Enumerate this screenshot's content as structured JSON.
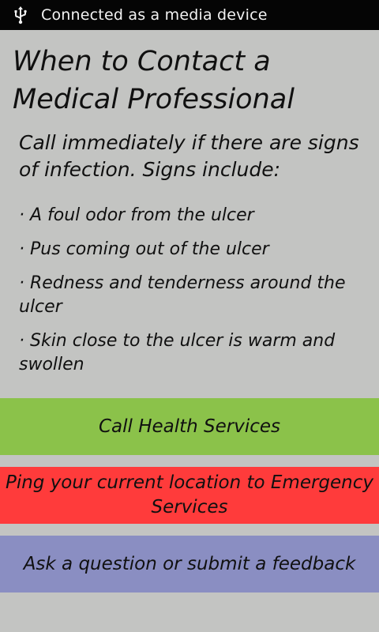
{
  "status_bar": {
    "icon": "usb-icon",
    "text": "Connected as a media device"
  },
  "page": {
    "title_lines": [
      "When to Contact a",
      "Medical Professional"
    ],
    "intro_lines": [
      "Call immediately if there are signs",
      "of infection. Signs include:"
    ],
    "signs": [
      {
        "lines": [
          "· A foul odor from the ulcer"
        ]
      },
      {
        "lines": [
          "· Pus coming out of the ulcer"
        ]
      },
      {
        "lines": [
          "· Redness and tenderness around the",
          "ulcer"
        ]
      },
      {
        "lines": [
          "· Skin close to the ulcer is warm and",
          "swollen"
        ]
      }
    ]
  },
  "buttons": {
    "call_health": {
      "label": "Call Health Services",
      "color": "#8bc24a"
    },
    "ping_location": {
      "lines": [
        "Ping your current location to Emergency",
        "Services"
      ],
      "color": "#ff3b3b"
    },
    "feedback": {
      "label": "Ask a question or submit a feedback",
      "color": "#8a8ec2"
    }
  },
  "colors": {
    "background": "#c3c4c2",
    "status_bar": "#050505"
  }
}
